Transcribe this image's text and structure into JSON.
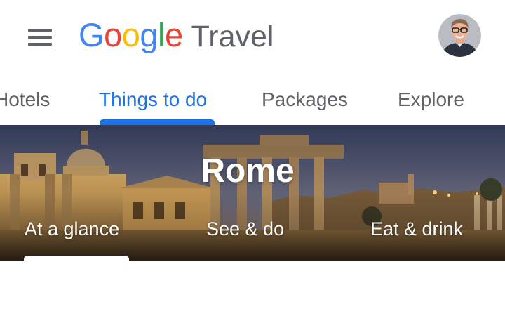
{
  "header": {
    "logo_letters": [
      {
        "char": "G",
        "color": "#4285f4"
      },
      {
        "char": "o",
        "color": "#ea4335"
      },
      {
        "char": "o",
        "color": "#fbbc05"
      },
      {
        "char": "g",
        "color": "#4285f4"
      },
      {
        "char": "l",
        "color": "#34a853"
      },
      {
        "char": "e",
        "color": "#ea4335"
      }
    ],
    "product": "Travel",
    "menu_icon": "hamburger-menu-icon",
    "avatar_icon": "user-avatar"
  },
  "tabs": [
    {
      "label": "Hotels",
      "active": false
    },
    {
      "label": "Things to do",
      "active": true
    },
    {
      "label": "Packages",
      "active": false
    },
    {
      "label": "Explore",
      "active": false
    }
  ],
  "hero": {
    "title": "Rome",
    "tabs": [
      {
        "label": "At a glance",
        "active": true
      },
      {
        "label": "See & do",
        "active": false
      },
      {
        "label": "Eat & drink",
        "active": false
      }
    ]
  },
  "colors": {
    "accent": "#1a73e8",
    "text_secondary": "#5f6368"
  }
}
